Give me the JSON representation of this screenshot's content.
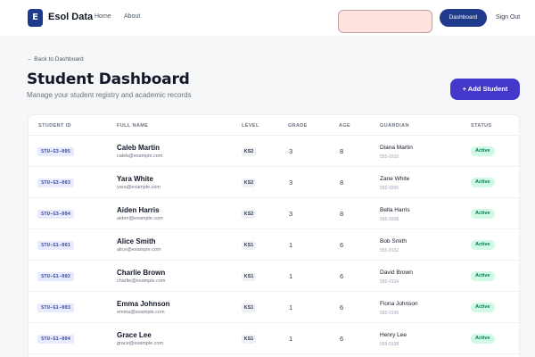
{
  "header": {
    "logo_letter": "E",
    "brand": "Esol Data",
    "nav": [
      "Home",
      "About"
    ],
    "dashboard_button": "Dashboard",
    "signout": "Sign Out"
  },
  "page": {
    "back_link": "← Back to Dashboard",
    "title": "Student Dashboard",
    "subtitle": "Manage your student registry and academic records",
    "add_button": "+ Add Student"
  },
  "table": {
    "columns": [
      "STUDENT ID",
      "FULL NAME",
      "LEVEL",
      "GRADE",
      "AGE",
      "GUARDIAN",
      "STATUS"
    ],
    "rows": [
      {
        "id": "STU-G3-005",
        "name": "Caleb Martin",
        "email": "caleb@example.com",
        "level": "KS2",
        "grade": "3",
        "age": "8",
        "guardian": "Diana Martin",
        "phone": "555-0310",
        "status": "Active"
      },
      {
        "id": "STU-G3-003",
        "name": "Yara White",
        "email": "yara@example.com",
        "level": "KS2",
        "grade": "3",
        "age": "8",
        "guardian": "Zane White",
        "phone": "555-0306",
        "status": "Active"
      },
      {
        "id": "STU-G3-004",
        "name": "Aiden Harris",
        "email": "aiden@example.com",
        "level": "KS2",
        "grade": "3",
        "age": "8",
        "guardian": "Bella Harris",
        "phone": "555-0308",
        "status": "Active"
      },
      {
        "id": "STU-G1-001",
        "name": "Alice Smith",
        "email": "alice@example.com",
        "level": "KS1",
        "grade": "1",
        "age": "6",
        "guardian": "Bob Smith",
        "phone": "555-0102",
        "status": "Active"
      },
      {
        "id": "STU-G1-002",
        "name": "Charlie Brown",
        "email": "charlie@example.com",
        "level": "KS1",
        "grade": "1",
        "age": "6",
        "guardian": "David Brown",
        "phone": "555-0104",
        "status": "Active"
      },
      {
        "id": "STU-G1-003",
        "name": "Emma Johnson",
        "email": "emma@example.com",
        "level": "KS1",
        "grade": "1",
        "age": "6",
        "guardian": "Fiona Johnson",
        "phone": "555-0106",
        "status": "Active"
      },
      {
        "id": "STU-G1-004",
        "name": "Grace Lee",
        "email": "grace@example.com",
        "level": "KS1",
        "grade": "1",
        "age": "6",
        "guardian": "Henry Lee",
        "phone": "555-0108",
        "status": "Active"
      }
    ]
  },
  "colors": {
    "brand": "#1e3a8a",
    "accent": "#4338ca",
    "search_bg": "#fde2de",
    "active_badge_bg": "#d1fae5",
    "active_badge_text": "#047857"
  }
}
